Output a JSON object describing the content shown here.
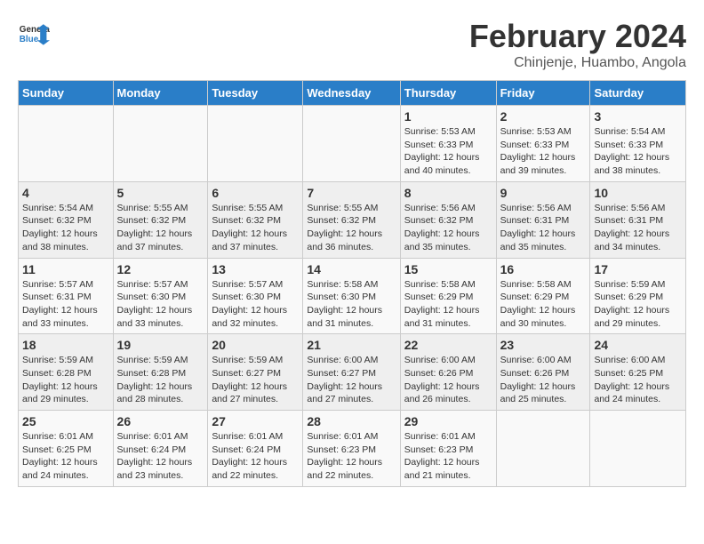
{
  "header": {
    "logo_general": "General",
    "logo_blue": "Blue",
    "month_title": "February 2024",
    "subtitle": "Chinjenje, Huambo, Angola"
  },
  "days_of_week": [
    "Sunday",
    "Monday",
    "Tuesday",
    "Wednesday",
    "Thursday",
    "Friday",
    "Saturday"
  ],
  "weeks": [
    [
      {
        "num": "",
        "info": ""
      },
      {
        "num": "",
        "info": ""
      },
      {
        "num": "",
        "info": ""
      },
      {
        "num": "",
        "info": ""
      },
      {
        "num": "1",
        "info": "Sunrise: 5:53 AM\nSunset: 6:33 PM\nDaylight: 12 hours\nand 40 minutes."
      },
      {
        "num": "2",
        "info": "Sunrise: 5:53 AM\nSunset: 6:33 PM\nDaylight: 12 hours\nand 39 minutes."
      },
      {
        "num": "3",
        "info": "Sunrise: 5:54 AM\nSunset: 6:33 PM\nDaylight: 12 hours\nand 38 minutes."
      }
    ],
    [
      {
        "num": "4",
        "info": "Sunrise: 5:54 AM\nSunset: 6:32 PM\nDaylight: 12 hours\nand 38 minutes."
      },
      {
        "num": "5",
        "info": "Sunrise: 5:55 AM\nSunset: 6:32 PM\nDaylight: 12 hours\nand 37 minutes."
      },
      {
        "num": "6",
        "info": "Sunrise: 5:55 AM\nSunset: 6:32 PM\nDaylight: 12 hours\nand 37 minutes."
      },
      {
        "num": "7",
        "info": "Sunrise: 5:55 AM\nSunset: 6:32 PM\nDaylight: 12 hours\nand 36 minutes."
      },
      {
        "num": "8",
        "info": "Sunrise: 5:56 AM\nSunset: 6:32 PM\nDaylight: 12 hours\nand 35 minutes."
      },
      {
        "num": "9",
        "info": "Sunrise: 5:56 AM\nSunset: 6:31 PM\nDaylight: 12 hours\nand 35 minutes."
      },
      {
        "num": "10",
        "info": "Sunrise: 5:56 AM\nSunset: 6:31 PM\nDaylight: 12 hours\nand 34 minutes."
      }
    ],
    [
      {
        "num": "11",
        "info": "Sunrise: 5:57 AM\nSunset: 6:31 PM\nDaylight: 12 hours\nand 33 minutes."
      },
      {
        "num": "12",
        "info": "Sunrise: 5:57 AM\nSunset: 6:30 PM\nDaylight: 12 hours\nand 33 minutes."
      },
      {
        "num": "13",
        "info": "Sunrise: 5:57 AM\nSunset: 6:30 PM\nDaylight: 12 hours\nand 32 minutes."
      },
      {
        "num": "14",
        "info": "Sunrise: 5:58 AM\nSunset: 6:30 PM\nDaylight: 12 hours\nand 31 minutes."
      },
      {
        "num": "15",
        "info": "Sunrise: 5:58 AM\nSunset: 6:29 PM\nDaylight: 12 hours\nand 31 minutes."
      },
      {
        "num": "16",
        "info": "Sunrise: 5:58 AM\nSunset: 6:29 PM\nDaylight: 12 hours\nand 30 minutes."
      },
      {
        "num": "17",
        "info": "Sunrise: 5:59 AM\nSunset: 6:29 PM\nDaylight: 12 hours\nand 29 minutes."
      }
    ],
    [
      {
        "num": "18",
        "info": "Sunrise: 5:59 AM\nSunset: 6:28 PM\nDaylight: 12 hours\nand 29 minutes."
      },
      {
        "num": "19",
        "info": "Sunrise: 5:59 AM\nSunset: 6:28 PM\nDaylight: 12 hours\nand 28 minutes."
      },
      {
        "num": "20",
        "info": "Sunrise: 5:59 AM\nSunset: 6:27 PM\nDaylight: 12 hours\nand 27 minutes."
      },
      {
        "num": "21",
        "info": "Sunrise: 6:00 AM\nSunset: 6:27 PM\nDaylight: 12 hours\nand 27 minutes."
      },
      {
        "num": "22",
        "info": "Sunrise: 6:00 AM\nSunset: 6:26 PM\nDaylight: 12 hours\nand 26 minutes."
      },
      {
        "num": "23",
        "info": "Sunrise: 6:00 AM\nSunset: 6:26 PM\nDaylight: 12 hours\nand 25 minutes."
      },
      {
        "num": "24",
        "info": "Sunrise: 6:00 AM\nSunset: 6:25 PM\nDaylight: 12 hours\nand 24 minutes."
      }
    ],
    [
      {
        "num": "25",
        "info": "Sunrise: 6:01 AM\nSunset: 6:25 PM\nDaylight: 12 hours\nand 24 minutes."
      },
      {
        "num": "26",
        "info": "Sunrise: 6:01 AM\nSunset: 6:24 PM\nDaylight: 12 hours\nand 23 minutes."
      },
      {
        "num": "27",
        "info": "Sunrise: 6:01 AM\nSunset: 6:24 PM\nDaylight: 12 hours\nand 22 minutes."
      },
      {
        "num": "28",
        "info": "Sunrise: 6:01 AM\nSunset: 6:23 PM\nDaylight: 12 hours\nand 22 minutes."
      },
      {
        "num": "29",
        "info": "Sunrise: 6:01 AM\nSunset: 6:23 PM\nDaylight: 12 hours\nand 21 minutes."
      },
      {
        "num": "",
        "info": ""
      },
      {
        "num": "",
        "info": ""
      }
    ]
  ]
}
